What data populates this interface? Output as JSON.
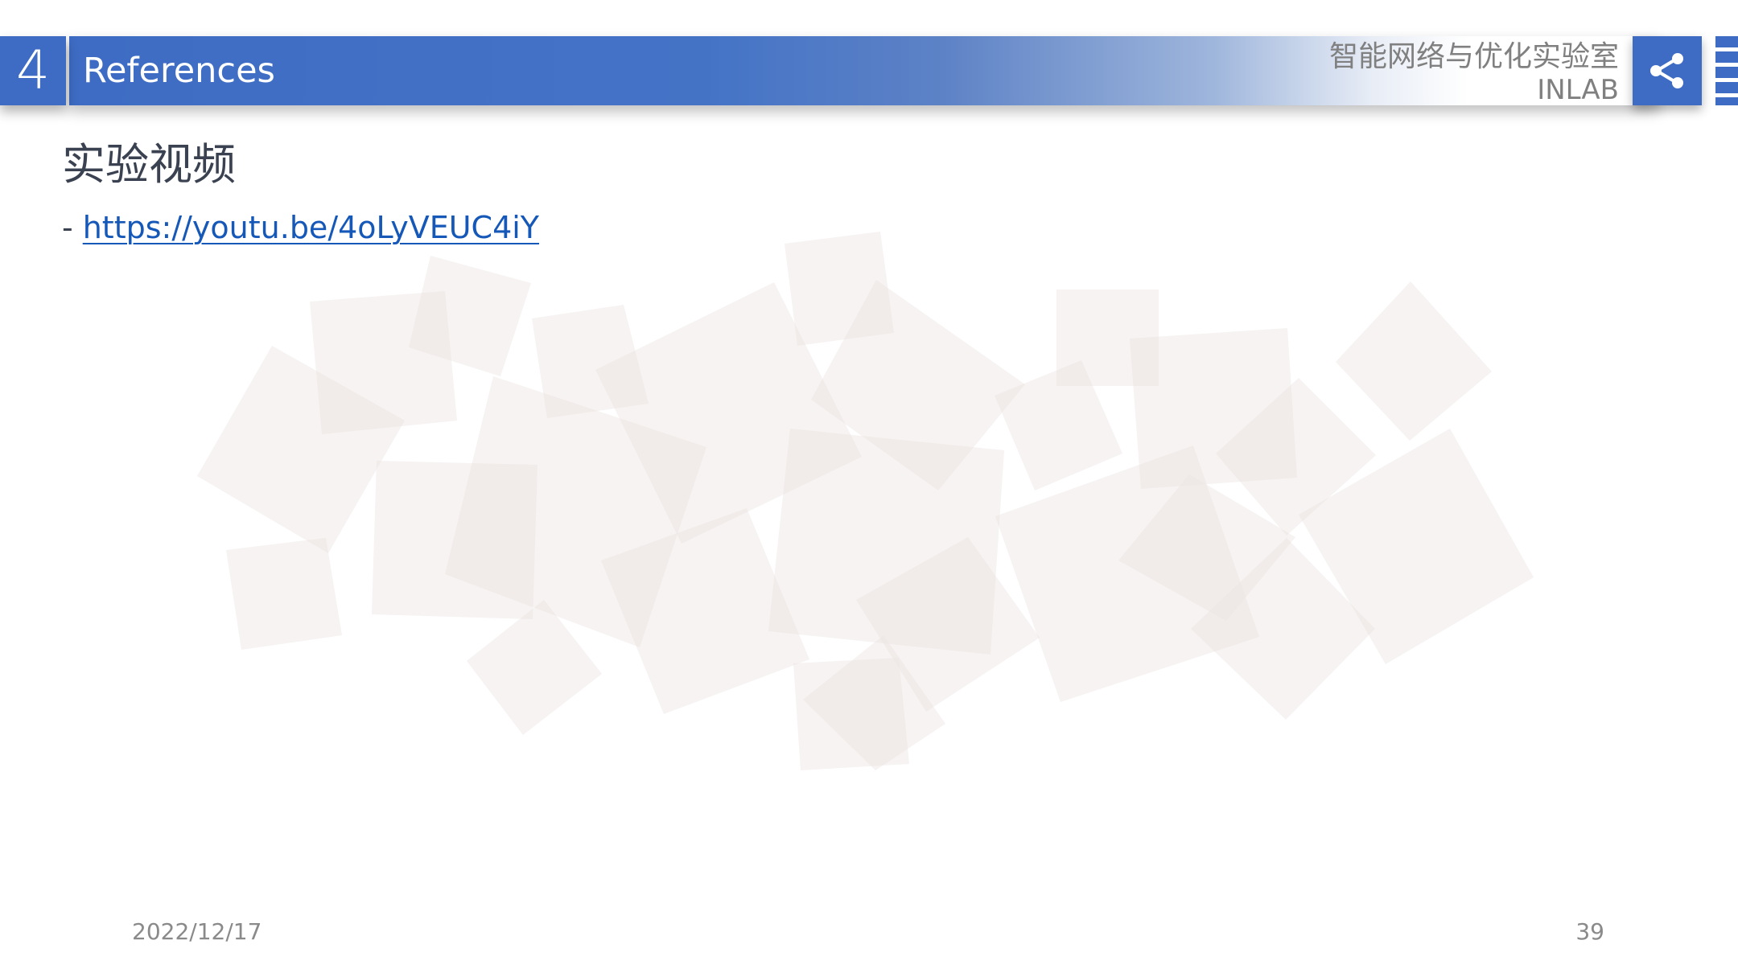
{
  "header": {
    "section_number": "4",
    "title": "References",
    "lab_name_cn": "智能网络与优化实验室",
    "lab_name_en": "INLAB",
    "share_icon": "share-icon"
  },
  "content": {
    "heading": "实验视频",
    "bullets": [
      {
        "prefix": "-",
        "link_text": "https://youtu.be/4oLyVEUC4iY"
      }
    ]
  },
  "footer": {
    "date": "2022/12/17",
    "page_number": "39"
  },
  "colors": {
    "accent_blue": "#3e6cc4",
    "link_blue": "#1558b8",
    "heading_text": "#3a4150",
    "muted_text": "#8a8a8a",
    "decor_shape": "#ede8e6"
  }
}
